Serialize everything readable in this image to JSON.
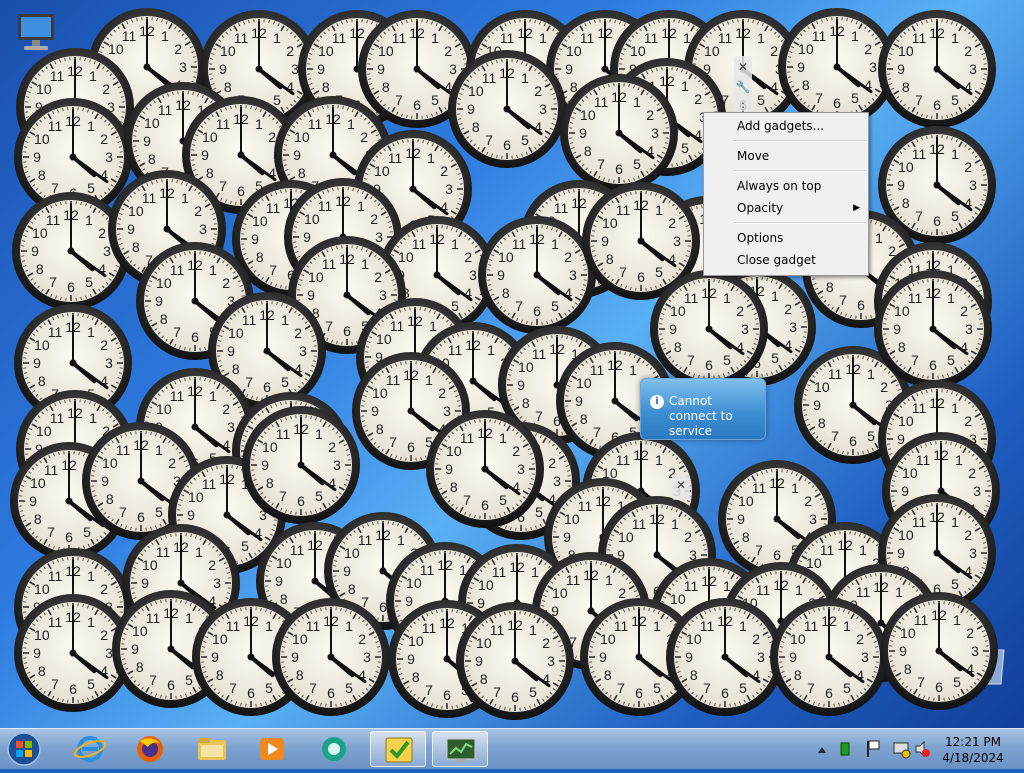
{
  "desktop": {
    "icons": [
      {
        "name": "computer-icon"
      },
      {
        "name": "recycle-bin-icon"
      }
    ],
    "clock_gadget": {
      "icon": "analog-clock-gadget",
      "hour_numerals": [
        "12",
        "1",
        "2",
        "3",
        "4",
        "5",
        "6",
        "7",
        "8",
        "9",
        "10",
        "11"
      ],
      "displayed_time": "4:21"
    },
    "gadget_toolbar": {
      "close": "close-icon",
      "options": "wrench-icon",
      "drag": "drag-handle-icon"
    }
  },
  "context_menu": {
    "items": [
      {
        "label": "Add gadgets...",
        "separator_after": true
      },
      {
        "label": "Move",
        "separator_after": true
      },
      {
        "label": "Always on top",
        "separator_after": false
      },
      {
        "label": "Opacity",
        "separator_after": true,
        "submenu": true
      },
      {
        "label": "Options",
        "separator_after": false
      },
      {
        "label": "Close gadget",
        "separator_after": false
      }
    ]
  },
  "error_tooltip": {
    "icon": "info-icon",
    "text": "Cannot connect to service"
  },
  "taskbar": {
    "start_button": "windows-start-orb",
    "pinned": [
      {
        "name": "internet-explorer",
        "active": false
      },
      {
        "name": "firefox",
        "active": false
      },
      {
        "name": "file-explorer",
        "active": false
      },
      {
        "name": "media-player",
        "active": false
      },
      {
        "name": "app-green",
        "active": false
      },
      {
        "name": "task-scheduler",
        "active": true
      },
      {
        "name": "system-monitor",
        "active": true
      }
    ],
    "tray": {
      "icons": [
        "show-hidden-icons",
        "battery-icon",
        "flag-icon",
        "network-icon",
        "volume-muted-icon"
      ],
      "time": "12:21 PM",
      "date": "4/18/2024"
    }
  },
  "colors": {
    "menu_bg": "#f0f0f0",
    "taskbar": "#7fa3cf",
    "tooltip": "#3f8fd2",
    "clock_face": "#f2eee4",
    "clock_rim": "#2b2b2b"
  }
}
